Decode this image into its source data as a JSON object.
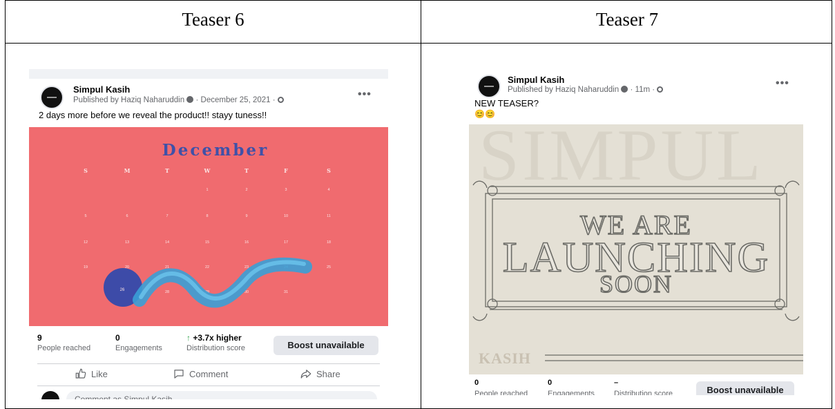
{
  "headers": {
    "left": "Teaser 6",
    "right": "Teaser 7"
  },
  "teaser6": {
    "page_name": "Simpul Kasih",
    "published": "Published by Haziq Naharuddin",
    "date": "December 25, 2021",
    "text": "2 days more before we reveal the product!! stayy tuness!!",
    "calendar": {
      "month": "December",
      "weekdays": [
        "S",
        "M",
        "T",
        "W",
        "T",
        "F",
        "S"
      ],
      "days": [
        "1",
        "2",
        "3",
        "4",
        "5",
        "6",
        "7",
        "8",
        "9",
        "10",
        "11",
        "12",
        "13",
        "14",
        "15",
        "16",
        "17",
        "18",
        "19",
        "20",
        "21",
        "22",
        "23",
        "24",
        "25",
        "26",
        "27",
        "28",
        "29",
        "30",
        "31"
      ],
      "highlight_day": "26"
    },
    "stats": {
      "reached_value": "9",
      "reached_label": "People reached",
      "engagements_value": "0",
      "engagements_label": "Engagements",
      "distribution_value": "+3.7x higher",
      "distribution_label": "Distribution score"
    },
    "boost_label": "Boost unavailable",
    "actions": {
      "like": "Like",
      "comment": "Comment",
      "share": "Share"
    },
    "comment_placeholder": "Comment as Simpul Kasih"
  },
  "teaser7": {
    "page_name": "Simpul Kasih",
    "published": "Published by Haziq Naharuddin",
    "time": "11m",
    "text": "NEW TEASER?",
    "emoji": "😊😊",
    "image": {
      "bg_word": "SIMPUL",
      "line1": "WE ARE",
      "line2": "LAUNCHING",
      "line3": "SOON",
      "brand": "KASIH"
    },
    "stats": {
      "reached_value": "0",
      "reached_label": "People reached",
      "engagements_value": "0",
      "engagements_label": "Engagements",
      "distribution_value": "–",
      "distribution_label": "Distribution score"
    },
    "boost_label": "Boost unavailable"
  },
  "colors": {
    "calendar_bg": "#f06b6f",
    "launch_bg": "#e4e0d5",
    "green_up": "#31a24c"
  }
}
